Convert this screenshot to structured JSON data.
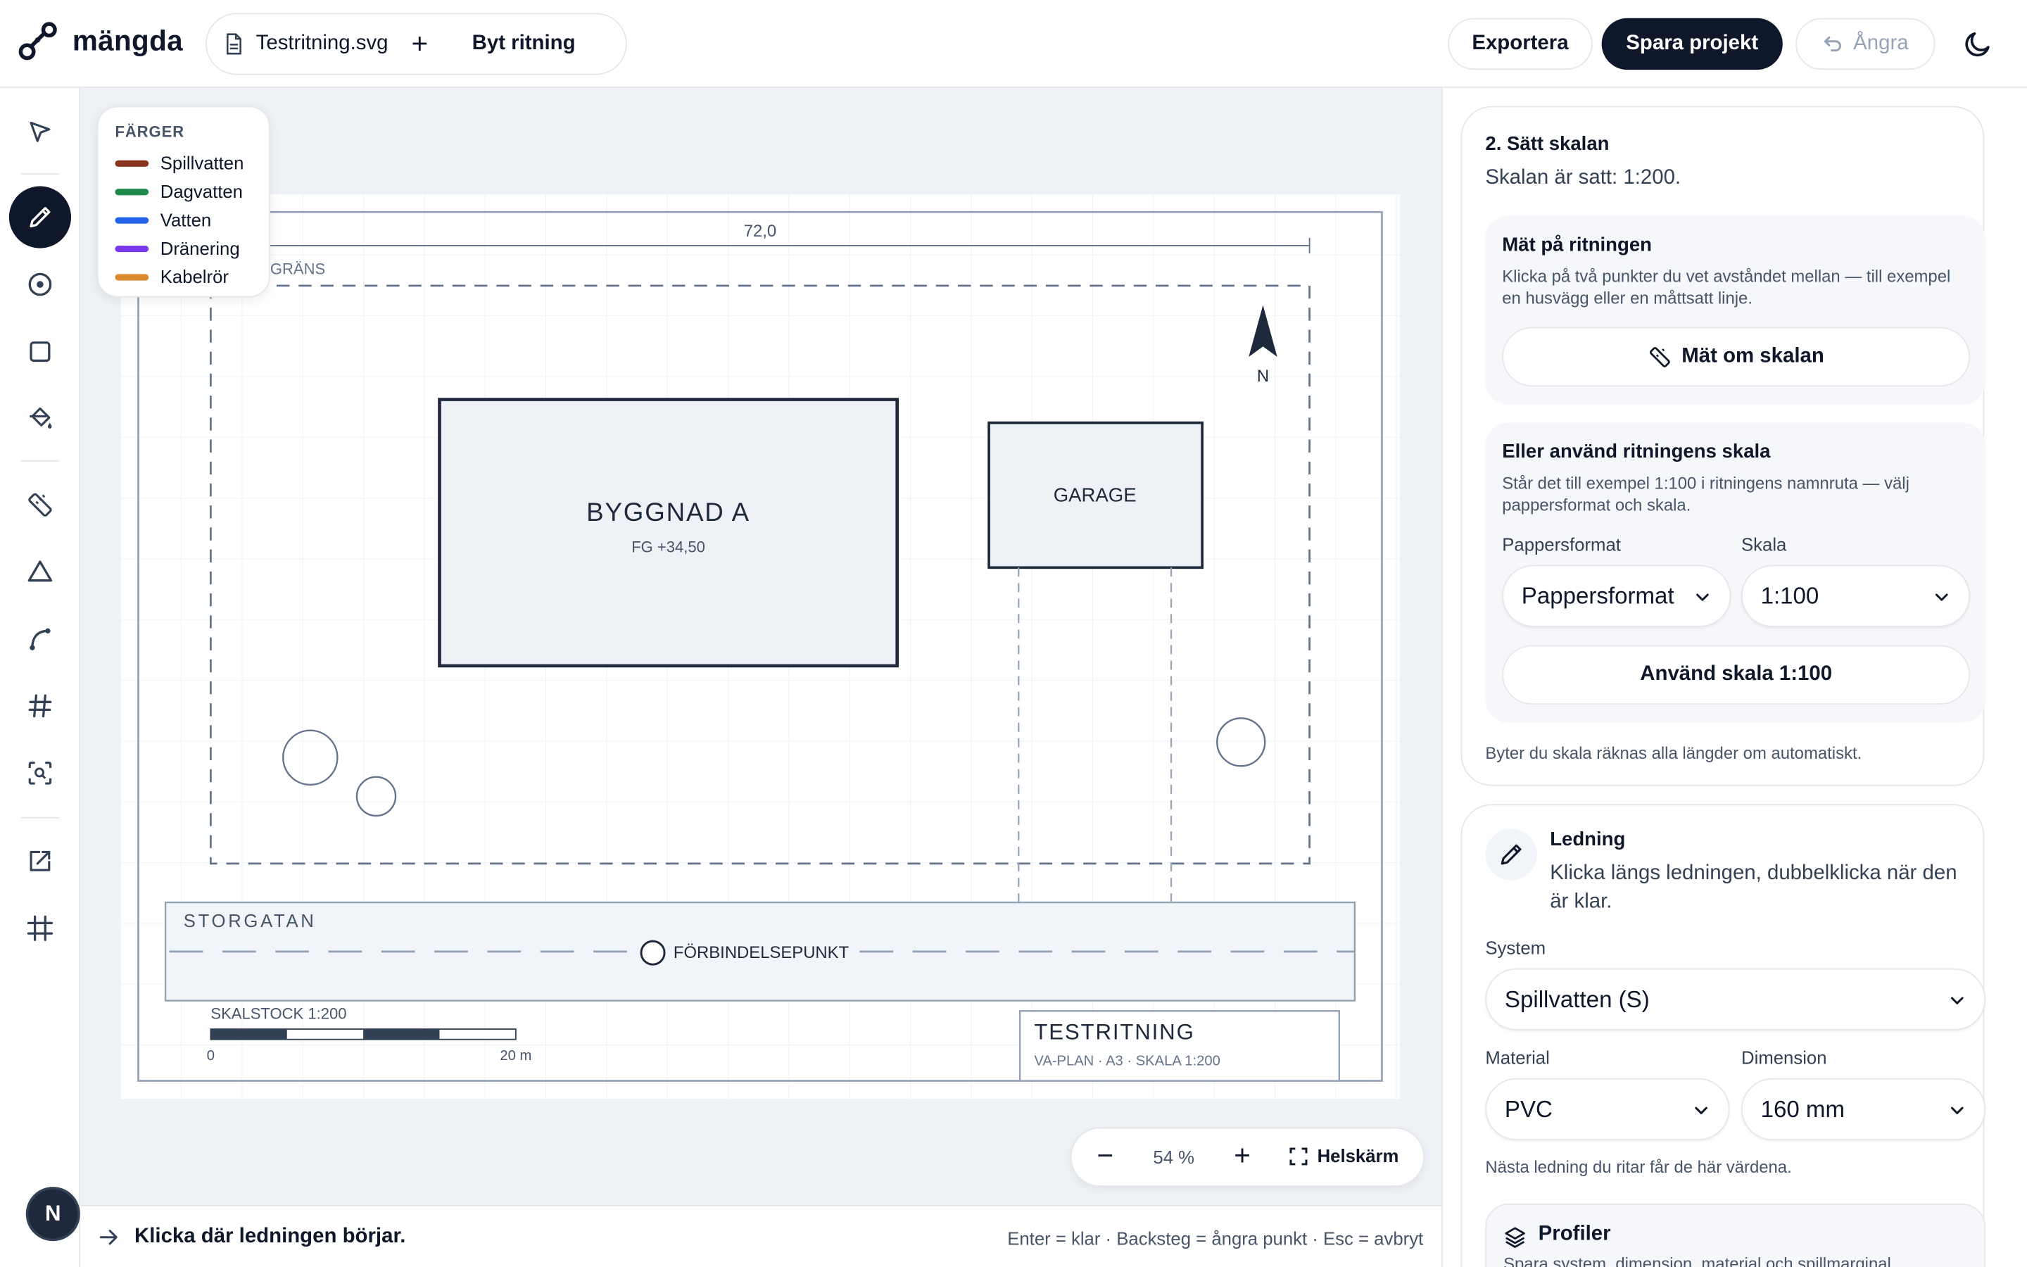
{
  "brand": {
    "name": "mängda"
  },
  "file": {
    "name": "Testritning.svg",
    "add_label": "+",
    "switch_label": "Byt ritning"
  },
  "toolbar": {
    "export_label": "Exportera",
    "save_label": "Spara projekt",
    "undo_label": "Ångra"
  },
  "tools": [
    {
      "name": "select",
      "icon": "cursor-icon"
    },
    {
      "name": "pen",
      "icon": "pencil-icon",
      "active": true
    },
    {
      "name": "point",
      "icon": "target-icon"
    },
    {
      "name": "rectangle",
      "icon": "square-icon"
    },
    {
      "name": "fill",
      "icon": "paint-bucket-icon"
    },
    {
      "name": "measure",
      "icon": "ruler-icon"
    },
    {
      "name": "area",
      "icon": "triangle-icon"
    },
    {
      "name": "curve",
      "icon": "curve-icon"
    },
    {
      "name": "grid",
      "icon": "hash-icon"
    },
    {
      "name": "zoom-area",
      "icon": "scan-search-icon"
    },
    {
      "name": "export",
      "icon": "external-edit-icon"
    },
    {
      "name": "frame",
      "icon": "frame-icon"
    }
  ],
  "user": {
    "initial": "N"
  },
  "legend": {
    "title": "FÄRGER",
    "items": [
      {
        "label": "Spillvatten",
        "color": "#8a3520"
      },
      {
        "label": "Dagvatten",
        "color": "#1f8a4c"
      },
      {
        "label": "Vatten",
        "color": "#2563eb"
      },
      {
        "label": "Dränering",
        "color": "#7c3aed"
      },
      {
        "label": "Kabelrör",
        "color": "#d98a2b"
      }
    ]
  },
  "drawing": {
    "dimension": "72,0",
    "property_line": "GRÄNS",
    "building_name": "BYGGNAD A",
    "building_level": "FG +34,50",
    "garage": "GARAGE",
    "north": "N",
    "street": "STORGATAN",
    "connection": "FÖRBINDELSEPUNKT",
    "scalebar_label": "SKALSTOCK 1:200",
    "scalebar_start": "0",
    "scalebar_end": "20 m",
    "titleblock_title": "TESTRITNING",
    "titleblock_sub": "VA-PLAN · A3 · SKALA 1:200"
  },
  "zoom": {
    "minus": "−",
    "value": "54 %",
    "plus": "+",
    "fullscreen": "Helskärm"
  },
  "status": {
    "text": "Klicka där ledningen börjar.",
    "hint": "Enter = klar · Backsteg = ångra punkt · Esc = avbryt"
  },
  "scale_panel": {
    "step_title": "2. Sätt skalan",
    "status": "Skalan är satt: 1:200.",
    "measure_title": "Mät på ritningen",
    "measure_desc": "Klicka på två punkter du vet avståndet mellan — till exempel en husvägg eller en måttsatt linje.",
    "measure_button": "Mät om skalan",
    "drawing_scale_title": "Eller använd ritningens skala",
    "drawing_scale_desc": "Står det till exempel 1:100 i ritningens namnruta — välj pappersformat och skala.",
    "paper_label": "Pappersformat",
    "paper_value": "Pappersformat",
    "scale_label": "Skala",
    "scale_value": "1:100",
    "apply_button": "Använd skala 1:100",
    "footnote": "Byter du skala räknas alla längder om automatiskt."
  },
  "ledning_panel": {
    "title": "Ledning",
    "desc": "Klicka längs ledningen, dubbelklicka när den är klar.",
    "system_label": "System",
    "system_value": "Spillvatten (S)",
    "material_label": "Material",
    "material_value": "PVC",
    "dimension_label": "Dimension",
    "dimension_value": "160 mm",
    "footnote": "Nästa ledning du ritar får de här värdena."
  },
  "profiler": {
    "title": "Profiler",
    "desc": "Spara system, dimension, material och spillmarginal"
  }
}
